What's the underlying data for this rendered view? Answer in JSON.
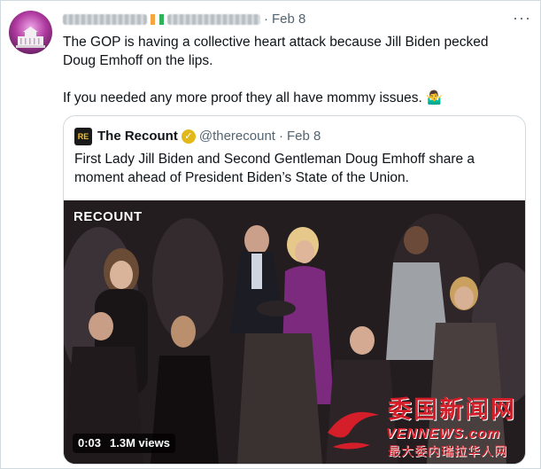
{
  "post": {
    "time": "Feb 8",
    "more_label": "···",
    "text_line1": "The GOP is having a collective heart attack because Jill Biden pecked Doug Emhoff on the lips.",
    "text_line2": "If you needed any more proof they all have mommy issues.",
    "emoji": "🤷‍♂️"
  },
  "quoted": {
    "logo_text": "RE",
    "name": "The Recount",
    "handle": "@therecount",
    "time": "Feb 8",
    "text": "First Lady Jill Biden and Second Gentleman Doug Emhoff share a moment ahead of President Biden’s State of the Union.",
    "video": {
      "watermark": "RECOUNT",
      "duration": "0:03",
      "views": "1.3M views"
    }
  },
  "site_watermark": {
    "cn": "委国新闻网",
    "en": "VENNEWS.com",
    "sub": "最大委内瑞拉华人网"
  },
  "colors": {
    "text": "#0f1419",
    "muted": "#536471",
    "border": "#cfd9de",
    "verified": "#e2b719",
    "watermark_red": "#d41f2a"
  }
}
